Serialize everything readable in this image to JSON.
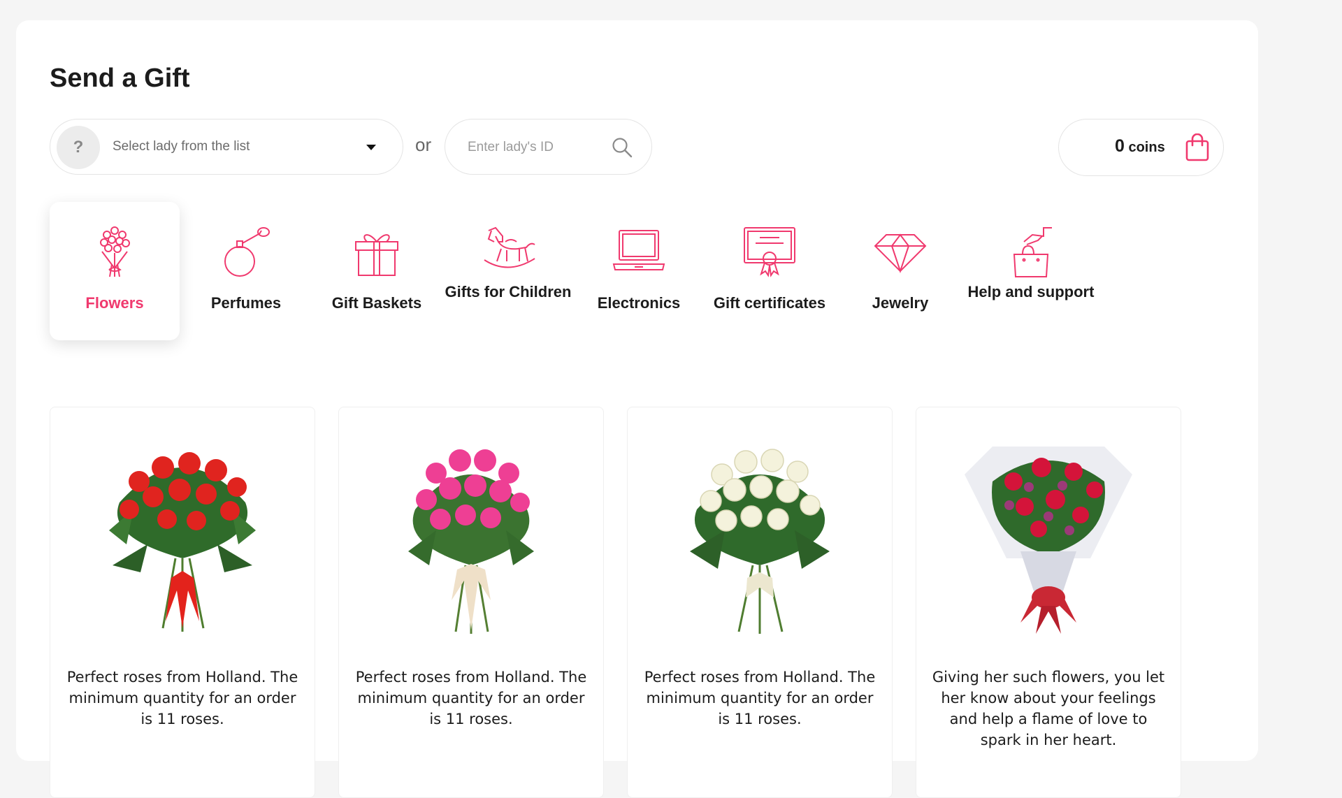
{
  "header": {
    "title": "Send a Gift"
  },
  "selector": {
    "question_mark": "?",
    "select_placeholder": "Select lady from the list",
    "or_label": "or",
    "id_placeholder": "Enter lady's ID"
  },
  "wallet": {
    "coins_value": "0",
    "coins_label": "coins"
  },
  "colors": {
    "accent": "#f0396e",
    "text": "#1c1c1c",
    "muted": "#6b6b6b"
  },
  "categories": [
    {
      "label": "Flowers",
      "icon": "bouquet-icon",
      "active": true
    },
    {
      "label": "Perfumes",
      "icon": "perfume-icon"
    },
    {
      "label": "Gift Baskets",
      "icon": "gift-box-icon"
    },
    {
      "label": "Gifts for Children",
      "icon": "rocking-horse-icon"
    },
    {
      "label": "Electronics",
      "icon": "laptop-icon"
    },
    {
      "label": "Gift certificates",
      "icon": "certificate-icon"
    },
    {
      "label": "Jewelry",
      "icon": "diamond-icon"
    },
    {
      "label": "Help and support",
      "icon": "hand-shopping-bag-icon"
    }
  ],
  "products": [
    {
      "image": "red-roses-bouquet",
      "description": "Perfect roses from Holland. The minimum quantity for an order is 11 roses."
    },
    {
      "image": "pink-roses-bouquet",
      "description": "Perfect roses from Holland. The minimum quantity for an order is 11 roses."
    },
    {
      "image": "white-roses-bouquet",
      "description": "Perfect roses from Holland. The minimum quantity for an order is 11 roses."
    },
    {
      "image": "mixed-red-bouquet",
      "description": "Giving her such flowers, you let her know about your feelings and help a flame of love to spark in her heart."
    }
  ]
}
